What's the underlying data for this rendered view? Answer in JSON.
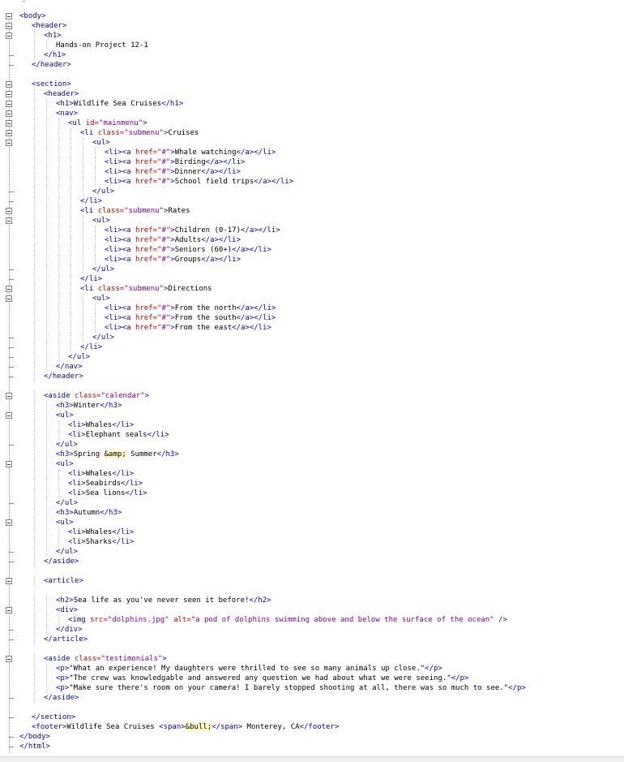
{
  "editor": {
    "top_fragment": "-",
    "lines": [
      {
        "indent": 0,
        "fold": true,
        "tokens": [
          [
            "tg",
            "<body>"
          ]
        ]
      },
      {
        "indent": 1,
        "fold": true,
        "tokens": [
          [
            "tg",
            "<header>"
          ]
        ]
      },
      {
        "indent": 2,
        "fold": true,
        "tokens": [
          [
            "tg",
            "<h1>"
          ]
        ]
      },
      {
        "indent": 3,
        "fold": false,
        "tokens": [
          [
            "tx",
            "Hands-on Project 12-1"
          ]
        ]
      },
      {
        "indent": 2,
        "fold": false,
        "tokens": [
          [
            "tg",
            "</h1>"
          ]
        ]
      },
      {
        "indent": 1,
        "fold": false,
        "tokens": [
          [
            "tg",
            "</header>"
          ]
        ]
      },
      {
        "indent": 0,
        "fold": false,
        "tokens": []
      },
      {
        "indent": 1,
        "fold": true,
        "tokens": [
          [
            "tg",
            "<section>"
          ]
        ]
      },
      {
        "indent": 2,
        "fold": true,
        "tokens": [
          [
            "tg",
            "<header>"
          ]
        ]
      },
      {
        "indent": 3,
        "fold": true,
        "tokens": [
          [
            "tg",
            "<h1>"
          ],
          [
            "tx",
            "Wildlife Sea Cruises"
          ],
          [
            "tg",
            "</h1>"
          ]
        ]
      },
      {
        "indent": 3,
        "fold": true,
        "tokens": [
          [
            "tg",
            "<nav>"
          ]
        ]
      },
      {
        "indent": 4,
        "fold": true,
        "tokens": [
          [
            "tg",
            "<ul "
          ],
          [
            "at",
            "id="
          ],
          [
            "vl",
            "\"mainmenu\""
          ],
          [
            "tg",
            ">"
          ]
        ]
      },
      {
        "indent": 5,
        "fold": true,
        "tokens": [
          [
            "tg",
            "<li "
          ],
          [
            "at",
            "class="
          ],
          [
            "vl",
            "\"submenu\""
          ],
          [
            "tg",
            ">"
          ],
          [
            "tx",
            "Cruises"
          ]
        ]
      },
      {
        "indent": 6,
        "fold": true,
        "tokens": [
          [
            "tg",
            "<ul>"
          ]
        ]
      },
      {
        "indent": 7,
        "fold": false,
        "tokens": [
          [
            "tg",
            "<li><a "
          ],
          [
            "at",
            "href="
          ],
          [
            "vl",
            "\"#\""
          ],
          [
            "tg",
            ">"
          ],
          [
            "tx",
            "Whale watching"
          ],
          [
            "tg",
            "</a></li>"
          ]
        ]
      },
      {
        "indent": 7,
        "fold": false,
        "tokens": [
          [
            "tg",
            "<li><a "
          ],
          [
            "at",
            "href="
          ],
          [
            "vl",
            "\"#\""
          ],
          [
            "tg",
            ">"
          ],
          [
            "tx",
            "Birding"
          ],
          [
            "tg",
            "</a></li>"
          ]
        ]
      },
      {
        "indent": 7,
        "fold": false,
        "tokens": [
          [
            "tg",
            "<li><a "
          ],
          [
            "at",
            "href="
          ],
          [
            "vl",
            "\"#\""
          ],
          [
            "tg",
            ">"
          ],
          [
            "tx",
            "Dinner"
          ],
          [
            "tg",
            "</a></li>"
          ]
        ]
      },
      {
        "indent": 7,
        "fold": false,
        "tokens": [
          [
            "tg",
            "<li><a "
          ],
          [
            "at",
            "href="
          ],
          [
            "vl",
            "\"#\""
          ],
          [
            "tg",
            ">"
          ],
          [
            "tx",
            "School field trips"
          ],
          [
            "tg",
            "</a></li>"
          ]
        ]
      },
      {
        "indent": 6,
        "fold": false,
        "tokens": [
          [
            "tg",
            "</ul>"
          ]
        ]
      },
      {
        "indent": 5,
        "fold": false,
        "tokens": [
          [
            "tg",
            "</li>"
          ]
        ]
      },
      {
        "indent": 5,
        "fold": true,
        "tokens": [
          [
            "tg",
            "<li "
          ],
          [
            "at",
            "class="
          ],
          [
            "vl",
            "\"submenu\""
          ],
          [
            "tg",
            ">"
          ],
          [
            "tx",
            "Rates"
          ]
        ]
      },
      {
        "indent": 6,
        "fold": true,
        "tokens": [
          [
            "tg",
            "<ul>"
          ]
        ]
      },
      {
        "indent": 7,
        "fold": false,
        "tokens": [
          [
            "tg",
            "<li><a "
          ],
          [
            "at",
            "href="
          ],
          [
            "vl",
            "\"#\""
          ],
          [
            "tg",
            ">"
          ],
          [
            "tx",
            "Children (0-17)"
          ],
          [
            "tg",
            "</a></li>"
          ]
        ]
      },
      {
        "indent": 7,
        "fold": false,
        "tokens": [
          [
            "tg",
            "<li><a "
          ],
          [
            "at",
            "href="
          ],
          [
            "vl",
            "\"#\""
          ],
          [
            "tg",
            ">"
          ],
          [
            "tx",
            "Adults"
          ],
          [
            "tg",
            "</a></li>"
          ]
        ]
      },
      {
        "indent": 7,
        "fold": false,
        "tokens": [
          [
            "tg",
            "<li><a "
          ],
          [
            "at",
            "href="
          ],
          [
            "vl",
            "\"#\""
          ],
          [
            "tg",
            ">"
          ],
          [
            "tx",
            "Seniors (60+)"
          ],
          [
            "tg",
            "</a></li>"
          ]
        ]
      },
      {
        "indent": 7,
        "fold": false,
        "tokens": [
          [
            "tg",
            "<li><a "
          ],
          [
            "at",
            "href="
          ],
          [
            "vl",
            "\"#\""
          ],
          [
            "tg",
            ">"
          ],
          [
            "tx",
            "Groups"
          ],
          [
            "tg",
            "</a></li>"
          ]
        ]
      },
      {
        "indent": 6,
        "fold": false,
        "tokens": [
          [
            "tg",
            "</ul>"
          ]
        ]
      },
      {
        "indent": 5,
        "fold": false,
        "tokens": [
          [
            "tg",
            "</li>"
          ]
        ]
      },
      {
        "indent": 5,
        "fold": true,
        "tokens": [
          [
            "tg",
            "<li "
          ],
          [
            "at",
            "class="
          ],
          [
            "vl",
            "\"submenu\""
          ],
          [
            "tg",
            ">"
          ],
          [
            "tx",
            "Directions"
          ]
        ]
      },
      {
        "indent": 6,
        "fold": true,
        "tokens": [
          [
            "tg",
            "<ul>"
          ]
        ]
      },
      {
        "indent": 7,
        "fold": false,
        "tokens": [
          [
            "tg",
            "<li><a "
          ],
          [
            "at",
            "href="
          ],
          [
            "vl",
            "\"#\""
          ],
          [
            "tg",
            ">"
          ],
          [
            "tx",
            "From the north"
          ],
          [
            "tg",
            "</a></li>"
          ]
        ]
      },
      {
        "indent": 7,
        "fold": false,
        "tokens": [
          [
            "tg",
            "<li><a "
          ],
          [
            "at",
            "href="
          ],
          [
            "vl",
            "\"#\""
          ],
          [
            "tg",
            ">"
          ],
          [
            "tx",
            "From the south"
          ],
          [
            "tg",
            "</a></li>"
          ]
        ]
      },
      {
        "indent": 7,
        "fold": false,
        "tokens": [
          [
            "tg",
            "<li><a "
          ],
          [
            "at",
            "href="
          ],
          [
            "vl",
            "\"#\""
          ],
          [
            "tg",
            ">"
          ],
          [
            "tx",
            "From the east"
          ],
          [
            "tg",
            "</a></li>"
          ]
        ]
      },
      {
        "indent": 6,
        "fold": false,
        "tokens": [
          [
            "tg",
            "</ul>"
          ]
        ]
      },
      {
        "indent": 5,
        "fold": false,
        "tokens": [
          [
            "tg",
            "</li>"
          ]
        ]
      },
      {
        "indent": 4,
        "fold": false,
        "tokens": [
          [
            "tg",
            "</ul>"
          ]
        ]
      },
      {
        "indent": 3,
        "fold": false,
        "tokens": [
          [
            "tg",
            "</nav>"
          ]
        ]
      },
      {
        "indent": 2,
        "fold": false,
        "tokens": [
          [
            "tg",
            "</header>"
          ]
        ]
      },
      {
        "indent": 0,
        "fold": false,
        "tokens": []
      },
      {
        "indent": 2,
        "fold": true,
        "tokens": [
          [
            "tg",
            "<aside "
          ],
          [
            "at",
            "class="
          ],
          [
            "vl",
            "\"calendar\""
          ],
          [
            "tg",
            ">"
          ]
        ]
      },
      {
        "indent": 3,
        "fold": false,
        "tokens": [
          [
            "tg",
            "<h3>"
          ],
          [
            "tx",
            "Winter"
          ],
          [
            "tg",
            "</h3>"
          ]
        ]
      },
      {
        "indent": 3,
        "fold": true,
        "tokens": [
          [
            "tg",
            "<ul>"
          ]
        ]
      },
      {
        "indent": 4,
        "fold": false,
        "tokens": [
          [
            "tg",
            "<li>"
          ],
          [
            "tx",
            "Whales"
          ],
          [
            "tg",
            "</li>"
          ]
        ]
      },
      {
        "indent": 4,
        "fold": false,
        "tokens": [
          [
            "tg",
            "<li>"
          ],
          [
            "tx",
            "Elephant seals"
          ],
          [
            "tg",
            "</li>"
          ]
        ]
      },
      {
        "indent": 3,
        "fold": false,
        "tokens": [
          [
            "tg",
            "</ul>"
          ]
        ]
      },
      {
        "indent": 3,
        "fold": false,
        "tokens": [
          [
            "tg",
            "<h3>"
          ],
          [
            "tx",
            "Spring "
          ],
          [
            "en",
            "&amp;"
          ],
          [
            "tx",
            " Summer"
          ],
          [
            "tg",
            "</h3>"
          ]
        ]
      },
      {
        "indent": 3,
        "fold": true,
        "tokens": [
          [
            "tg",
            "<ul>"
          ]
        ]
      },
      {
        "indent": 4,
        "fold": false,
        "tokens": [
          [
            "tg",
            "<li>"
          ],
          [
            "tx",
            "Whales"
          ],
          [
            "tg",
            "</li>"
          ]
        ]
      },
      {
        "indent": 4,
        "fold": false,
        "tokens": [
          [
            "tg",
            "<li>"
          ],
          [
            "tx",
            "Seabirds"
          ],
          [
            "tg",
            "</li>"
          ]
        ]
      },
      {
        "indent": 4,
        "fold": false,
        "tokens": [
          [
            "tg",
            "<li>"
          ],
          [
            "tx",
            "Sea lions"
          ],
          [
            "tg",
            "</li>"
          ]
        ]
      },
      {
        "indent": 3,
        "fold": false,
        "tokens": [
          [
            "tg",
            "</ul>"
          ]
        ]
      },
      {
        "indent": 3,
        "fold": false,
        "tokens": [
          [
            "tg",
            "<h3>"
          ],
          [
            "tx",
            "Autumn"
          ],
          [
            "tg",
            "</h3>"
          ]
        ]
      },
      {
        "indent": 3,
        "fold": true,
        "tokens": [
          [
            "tg",
            "<ul>"
          ]
        ]
      },
      {
        "indent": 4,
        "fold": false,
        "tokens": [
          [
            "tg",
            "<li>"
          ],
          [
            "tx",
            "Whales"
          ],
          [
            "tg",
            "</li>"
          ]
        ]
      },
      {
        "indent": 4,
        "fold": false,
        "tokens": [
          [
            "tg",
            "<li>"
          ],
          [
            "tx",
            "Sharks"
          ],
          [
            "tg",
            "</li>"
          ]
        ]
      },
      {
        "indent": 3,
        "fold": false,
        "tokens": [
          [
            "tg",
            "</ul>"
          ]
        ]
      },
      {
        "indent": 2,
        "fold": false,
        "tokens": [
          [
            "tg",
            "</aside>"
          ]
        ]
      },
      {
        "indent": 0,
        "fold": false,
        "tokens": []
      },
      {
        "indent": 2,
        "fold": true,
        "tokens": [
          [
            "tg",
            "<article>"
          ]
        ]
      },
      {
        "indent": 0,
        "fold": false,
        "tokens": []
      },
      {
        "indent": 3,
        "fold": false,
        "tokens": [
          [
            "tg",
            "<h2>"
          ],
          [
            "tx",
            "Sea life as you've never seen it before!"
          ],
          [
            "tg",
            "</h2>"
          ]
        ]
      },
      {
        "indent": 3,
        "fold": true,
        "tokens": [
          [
            "tg",
            "<div>"
          ]
        ]
      },
      {
        "indent": 4,
        "fold": false,
        "tokens": [
          [
            "tg",
            "<img "
          ],
          [
            "at",
            "src="
          ],
          [
            "vl",
            "\"dolphins.jpg\""
          ],
          [
            "tx",
            " "
          ],
          [
            "at",
            "alt="
          ],
          [
            "vl",
            "\"a pod of dolphins swimming above and below the surface of the ocean\""
          ],
          [
            "tg",
            " />"
          ]
        ]
      },
      {
        "indent": 3,
        "fold": false,
        "tokens": [
          [
            "tg",
            "</div>"
          ]
        ]
      },
      {
        "indent": 2,
        "fold": false,
        "tokens": [
          [
            "tg",
            "</article>"
          ]
        ]
      },
      {
        "indent": 0,
        "fold": false,
        "tokens": []
      },
      {
        "indent": 2,
        "fold": true,
        "tokens": [
          [
            "tg",
            "<aside "
          ],
          [
            "at",
            "class="
          ],
          [
            "vl",
            "\"testimonials\""
          ],
          [
            "tg",
            ">"
          ]
        ]
      },
      {
        "indent": 3,
        "fold": false,
        "tokens": [
          [
            "tg",
            "<p>"
          ],
          [
            "tx",
            "\"What an experience! My daughters were thrilled to see so many animals up close.\""
          ],
          [
            "tg",
            "</p>"
          ]
        ]
      },
      {
        "indent": 3,
        "fold": false,
        "tokens": [
          [
            "tg",
            "<p>"
          ],
          [
            "tx",
            "\"The crew was knowledgable and answered any question we had about what we were seeing.\""
          ],
          [
            "tg",
            "</p>"
          ]
        ]
      },
      {
        "indent": 3,
        "fold": false,
        "tokens": [
          [
            "tg",
            "<p>"
          ],
          [
            "tx",
            "\"Make sure there's room on your camera! I barely stopped shooting at all, there was so much to see.\""
          ],
          [
            "tg",
            "</p>"
          ]
        ]
      },
      {
        "indent": 2,
        "fold": false,
        "tokens": [
          [
            "tg",
            "</aside>"
          ]
        ]
      },
      {
        "indent": 0,
        "fold": false,
        "tokens": []
      },
      {
        "indent": 1,
        "fold": false,
        "tokens": [
          [
            "tg",
            "</section>"
          ]
        ]
      },
      {
        "indent": 1,
        "fold": false,
        "tokens": [
          [
            "tg",
            "<footer>"
          ],
          [
            "tx",
            "Wildlife Sea Cruises "
          ],
          [
            "tg",
            "<span>"
          ],
          [
            "en",
            "&bull;"
          ],
          [
            "tg",
            "</span>"
          ],
          [
            "tx",
            " Monterey, CA"
          ],
          [
            "tg",
            "</footer>"
          ]
        ]
      },
      {
        "indent": 0,
        "fold": false,
        "tokens": [
          [
            "tg",
            "</body>"
          ]
        ]
      },
      {
        "indent": 0,
        "fold": false,
        "tokens": [
          [
            "tg",
            "</html>"
          ]
        ]
      }
    ]
  }
}
